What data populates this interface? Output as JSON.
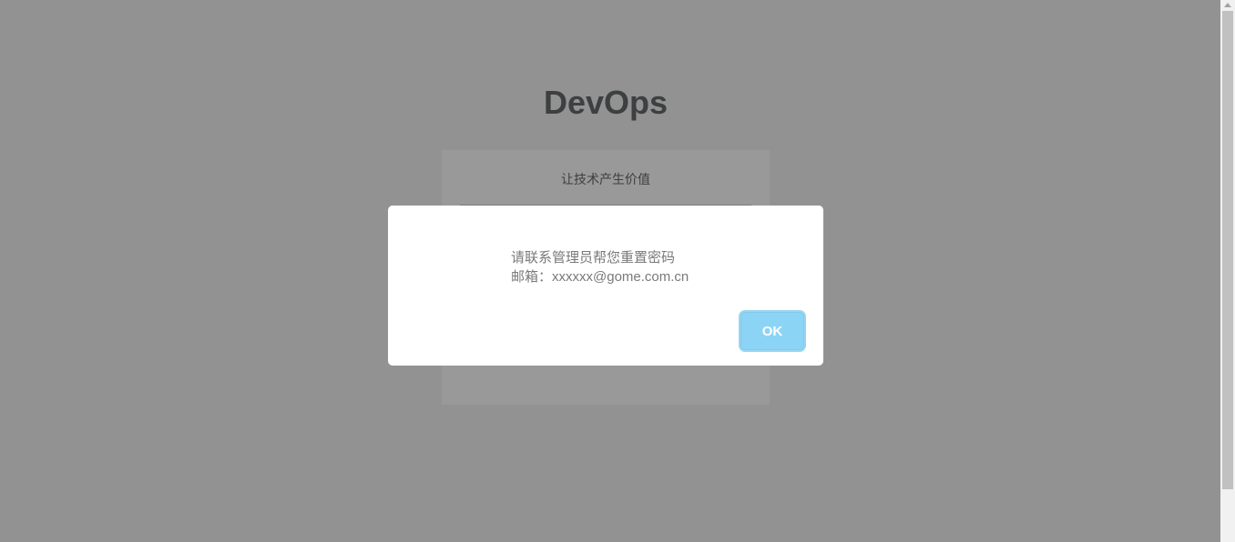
{
  "app": {
    "title": "DevOps",
    "slogan": "让技术产生价值"
  },
  "dialog": {
    "message_line1": "请联系管理员帮您重置密码",
    "message_line2": "邮箱：xxxxxx@gome.com.cn",
    "ok_label": "OK"
  },
  "colors": {
    "overlay": "rgba(0,0,0,0.4)",
    "button": "#8cd4f5",
    "title_text": "#676a6c"
  }
}
